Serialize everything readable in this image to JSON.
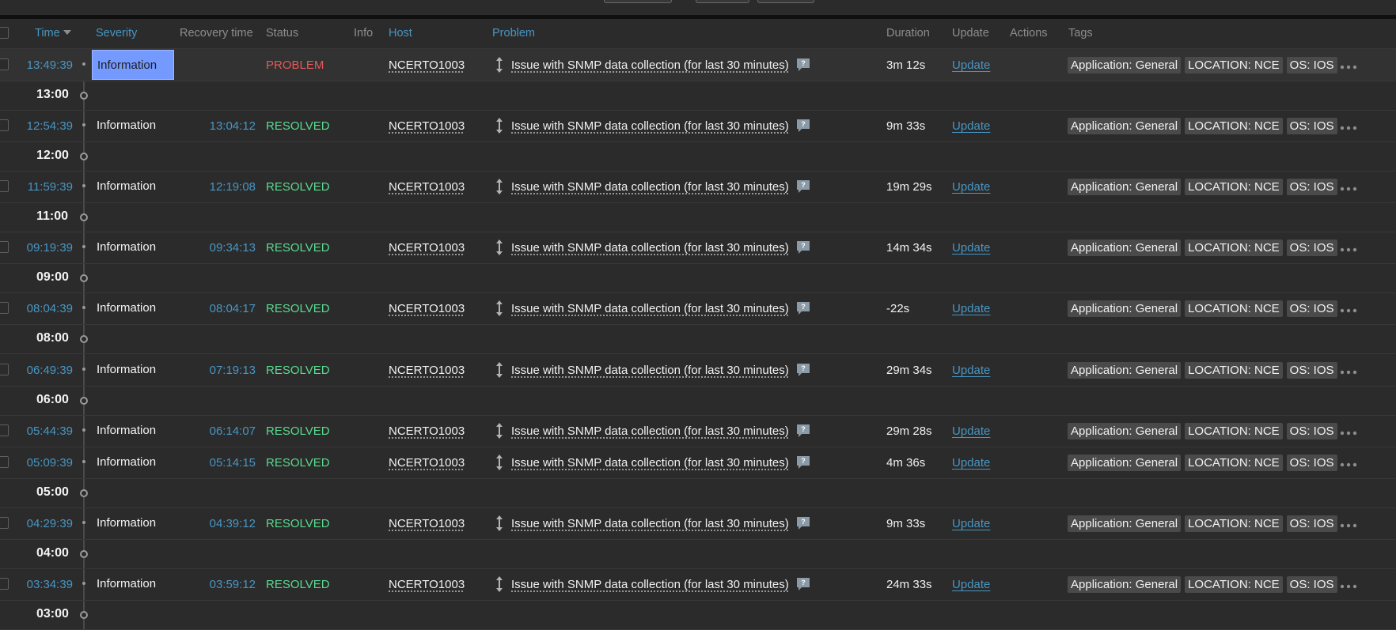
{
  "header": {
    "time": "Time",
    "severity": "Severity",
    "recovery_time": "Recovery time",
    "status": "Status",
    "info": "Info",
    "host": "Host",
    "problem": "Problem",
    "duration": "Duration",
    "update": "Update",
    "actions": "Actions",
    "tags": "Tags"
  },
  "hours": [
    "13:00",
    "12:00",
    "11:00",
    "09:00",
    "08:00",
    "06:00",
    "05:00",
    "04:00",
    "03:00"
  ],
  "events": [
    {
      "time": "13:49:39",
      "severity": "Information",
      "recovery": "",
      "status": "PROBLEM",
      "host": "NCERTO1003",
      "problem": "Issue with SNMP data collection (for last 30 minutes)",
      "duration": "3m 12s",
      "update": "Update",
      "tags": [
        "Application: General",
        "LOCATION: NCE",
        "OS: IOS"
      ]
    },
    {
      "time": "12:54:39",
      "severity": "Information",
      "recovery": "13:04:12",
      "status": "RESOLVED",
      "host": "NCERTO1003",
      "problem": "Issue with SNMP data collection (for last 30 minutes)",
      "duration": "9m 33s",
      "update": "Update",
      "tags": [
        "Application: General",
        "LOCATION: NCE",
        "OS: IOS"
      ]
    },
    {
      "time": "11:59:39",
      "severity": "Information",
      "recovery": "12:19:08",
      "status": "RESOLVED",
      "host": "NCERTO1003",
      "problem": "Issue with SNMP data collection (for last 30 minutes)",
      "duration": "19m 29s",
      "update": "Update",
      "tags": [
        "Application: General",
        "LOCATION: NCE",
        "OS: IOS"
      ]
    },
    {
      "time": "09:19:39",
      "severity": "Information",
      "recovery": "09:34:13",
      "status": "RESOLVED",
      "host": "NCERTO1003",
      "problem": "Issue with SNMP data collection (for last 30 minutes)",
      "duration": "14m 34s",
      "update": "Update",
      "tags": [
        "Application: General",
        "LOCATION: NCE",
        "OS: IOS"
      ]
    },
    {
      "time": "08:04:39",
      "severity": "Information",
      "recovery": "08:04:17",
      "status": "RESOLVED",
      "host": "NCERTO1003",
      "problem": "Issue with SNMP data collection (for last 30 minutes)",
      "duration": "-22s",
      "update": "Update",
      "tags": [
        "Application: General",
        "LOCATION: NCE",
        "OS: IOS"
      ]
    },
    {
      "time": "06:49:39",
      "severity": "Information",
      "recovery": "07:19:13",
      "status": "RESOLVED",
      "host": "NCERTO1003",
      "problem": "Issue with SNMP data collection (for last 30 minutes)",
      "duration": "29m 34s",
      "update": "Update",
      "tags": [
        "Application: General",
        "LOCATION: NCE",
        "OS: IOS"
      ]
    },
    {
      "time": "05:44:39",
      "severity": "Information",
      "recovery": "06:14:07",
      "status": "RESOLVED",
      "host": "NCERTO1003",
      "problem": "Issue with SNMP data collection (for last 30 minutes)",
      "duration": "29m 28s",
      "update": "Update",
      "tags": [
        "Application: General",
        "LOCATION: NCE",
        "OS: IOS"
      ]
    },
    {
      "time": "05:09:39",
      "severity": "Information",
      "recovery": "05:14:15",
      "status": "RESOLVED",
      "host": "NCERTO1003",
      "problem": "Issue with SNMP data collection (for last 30 minutes)",
      "duration": "4m 36s",
      "update": "Update",
      "tags": [
        "Application: General",
        "LOCATION: NCE",
        "OS: IOS"
      ]
    },
    {
      "time": "04:29:39",
      "severity": "Information",
      "recovery": "04:39:12",
      "status": "RESOLVED",
      "host": "NCERTO1003",
      "problem": "Issue with SNMP data collection (for last 30 minutes)",
      "duration": "9m 33s",
      "update": "Update",
      "tags": [
        "Application: General",
        "LOCATION: NCE",
        "OS: IOS"
      ]
    },
    {
      "time": "03:34:39",
      "severity": "Information",
      "recovery": "03:59:12",
      "status": "RESOLVED",
      "host": "NCERTO1003",
      "problem": "Issue with SNMP data collection (for last 30 minutes)",
      "duration": "24m 33s",
      "update": "Update",
      "tags": [
        "Application: General",
        "LOCATION: NCE",
        "OS: IOS"
      ]
    }
  ],
  "colors": {
    "background": "#2b2b2b",
    "link": "#4796c4",
    "problem": "#e45959",
    "resolved": "#59db8f",
    "severity_information": "#7499ff"
  }
}
